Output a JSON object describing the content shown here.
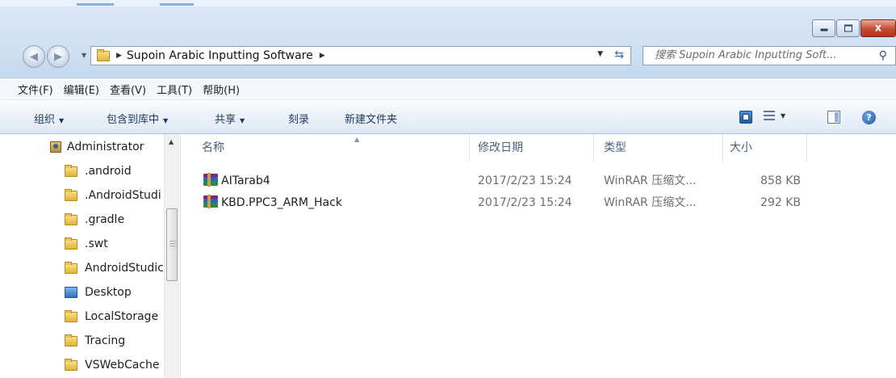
{
  "window": {
    "caption_buttons": {
      "minimize": "—",
      "maximize": "□",
      "close": "x"
    }
  },
  "nav": {
    "back_icon": "back-arrow-icon",
    "forward_icon": "forward-arrow-icon",
    "address_crumb": "Supoin Arabic Inputting Software",
    "search_placeholder": "搜索 Supoin Arabic Inputting Soft..."
  },
  "menu": [
    "文件(F)",
    "编辑(E)",
    "查看(V)",
    "工具(T)",
    "帮助(H)"
  ],
  "toolbar": {
    "organize": "组织",
    "include_library": "包含到库中",
    "share": "共享",
    "burn": "刻录",
    "new_folder": "新建文件夹"
  },
  "tree": {
    "items": [
      {
        "label": "Administrator",
        "icon": "user-folder"
      },
      {
        "label": ".android",
        "icon": "folder"
      },
      {
        "label": ".AndroidStudi",
        "icon": "folder"
      },
      {
        "label": ".gradle",
        "icon": "folder"
      },
      {
        "label": ".swt",
        "icon": "folder"
      },
      {
        "label": "AndroidStudic",
        "icon": "folder"
      },
      {
        "label": "Desktop",
        "icon": "desktop"
      },
      {
        "label": "LocalStorage",
        "icon": "folder"
      },
      {
        "label": "Tracing",
        "icon": "folder"
      },
      {
        "label": "VSWebCache",
        "icon": "folder"
      }
    ]
  },
  "columns": {
    "name": "名称",
    "modified": "修改日期",
    "type": "类型",
    "size": "大小"
  },
  "files": [
    {
      "name": "AITarab4",
      "modified": "2017/2/23 15:24",
      "type": "WinRAR 压缩文...",
      "size": "858 KB"
    },
    {
      "name": "KBD.PPC3_ARM_Hack",
      "modified": "2017/2/23 15:24",
      "type": "WinRAR 压缩文...",
      "size": "292 KB"
    }
  ],
  "colors": {
    "accent": "#2e6fb7",
    "window_frame": "#c7d9ee",
    "close": "#c44a32"
  }
}
